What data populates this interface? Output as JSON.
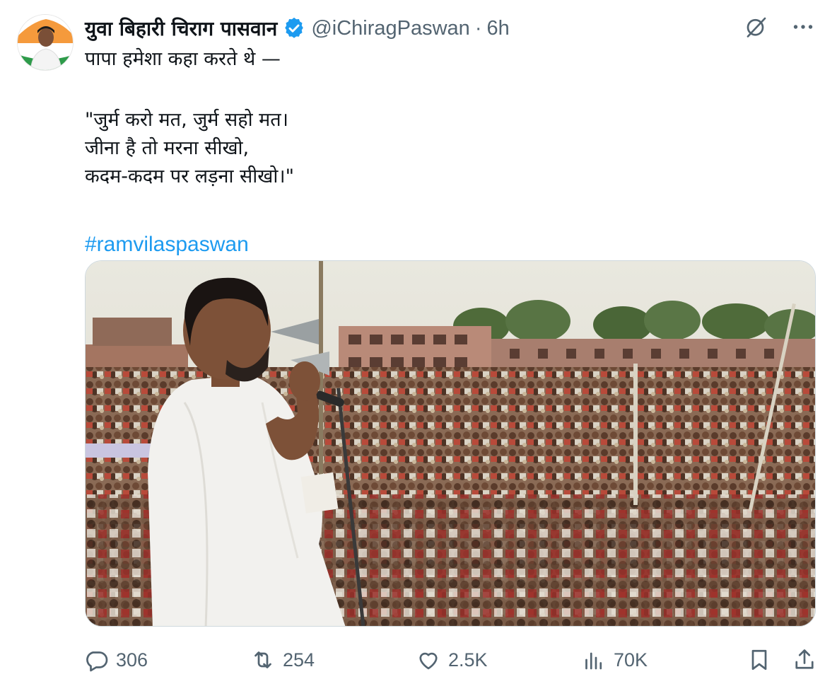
{
  "author": {
    "display_name": "युवा बिहारी चिराग पासवान",
    "handle": "@iChiragPaswan",
    "separator": "·",
    "time": "6h",
    "verified": true
  },
  "tweet": {
    "lines": [
      "पापा हमेशा कहा करते थे —",
      "\"जुर्म करो मत, जुर्म सहो मत।",
      "जीना है तो मरना सीखो,",
      "कदम-कदम पर लड़ना सीखो।\""
    ],
    "hashtag": "#ramvilaspaswan"
  },
  "icons": {
    "grok": "grok-icon",
    "more": "more-icon",
    "reply": "reply-icon",
    "retweet": "retweet-icon",
    "like": "heart-icon",
    "views": "views-icon",
    "bookmark": "bookmark-icon",
    "share": "share-icon"
  },
  "actions": {
    "replies": "306",
    "retweets": "254",
    "likes": "2.5K",
    "views": "70K"
  },
  "colors": {
    "link": "#1d9bf0",
    "secondary_text": "#536471",
    "primary_text": "#0f1419",
    "verified_badge": "#1d9bf0"
  }
}
